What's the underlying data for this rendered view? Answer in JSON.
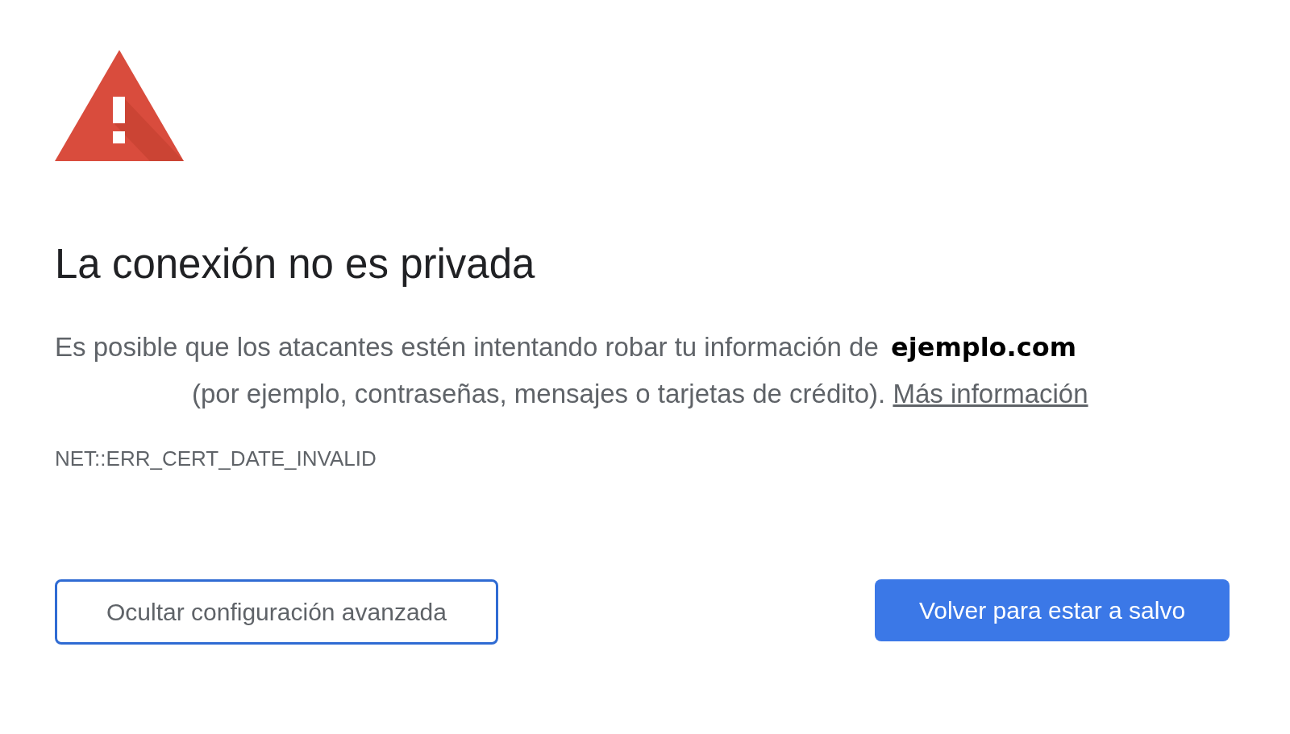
{
  "heading": "La conexión no es privada",
  "description": {
    "line_1": "Es posible que los atacantes estén intentando robar tu información de",
    "domain": "ejemplo.com",
    "line_2": "(por ejemplo, contraseñas, mensajes o tarjetas de crédito).",
    "link": "Más información"
  },
  "error_code": "NET::ERR_CERT_DATE_INVALID",
  "buttons": [
    {
      "label": "Ocultar configuración avanzada",
      "kind": "outline"
    },
    {
      "label": "Volver para estar a salvo",
      "kind": "primary"
    }
  ]
}
